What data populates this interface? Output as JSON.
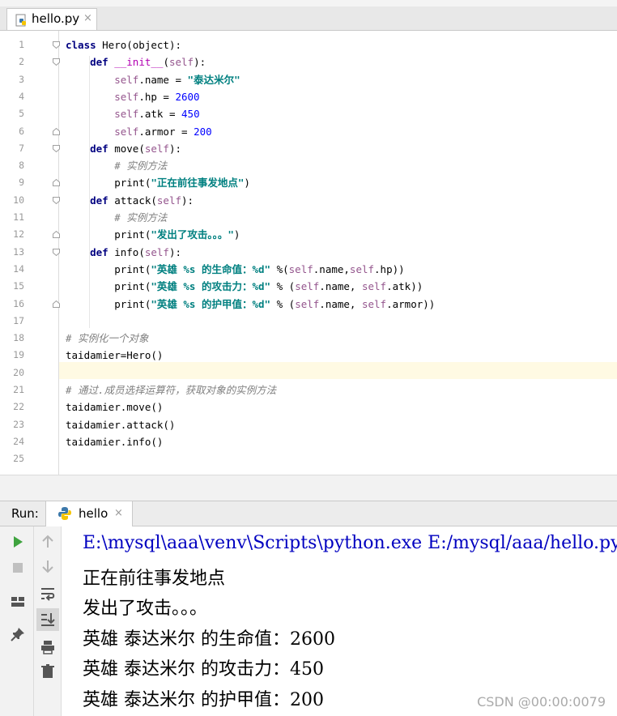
{
  "editor_tab": {
    "filename": "hello.py",
    "close": "×"
  },
  "code": {
    "line_numbers": [
      "1",
      "2",
      "3",
      "4",
      "5",
      "6",
      "7",
      "8",
      "9",
      "10",
      "11",
      "12",
      "13",
      "14",
      "15",
      "16",
      "17",
      "18",
      "19",
      "20",
      "21",
      "22",
      "23",
      "24",
      "25"
    ],
    "lines": [
      [
        {
          "t": "class ",
          "c": "kw"
        },
        {
          "t": "Hero(object):"
        }
      ],
      [
        {
          "t": "    "
        },
        {
          "t": "def ",
          "c": "kw"
        },
        {
          "t": "__init__",
          "c": "mg"
        },
        {
          "t": "("
        },
        {
          "t": "self",
          "c": "sf"
        },
        {
          "t": "):"
        }
      ],
      [
        {
          "t": "        "
        },
        {
          "t": "self",
          "c": "sf"
        },
        {
          "t": ".name = "
        },
        {
          "t": "\"泰达米尔\"",
          "c": "st"
        }
      ],
      [
        {
          "t": "        "
        },
        {
          "t": "self",
          "c": "sf"
        },
        {
          "t": ".hp = "
        },
        {
          "t": "2600",
          "c": "nu"
        }
      ],
      [
        {
          "t": "        "
        },
        {
          "t": "self",
          "c": "sf"
        },
        {
          "t": ".atk = "
        },
        {
          "t": "450",
          "c": "nu"
        }
      ],
      [
        {
          "t": "        "
        },
        {
          "t": "self",
          "c": "sf"
        },
        {
          "t": ".armor = "
        },
        {
          "t": "200",
          "c": "nu"
        }
      ],
      [
        {
          "t": "    "
        },
        {
          "t": "def ",
          "c": "kw"
        },
        {
          "t": "move("
        },
        {
          "t": "self",
          "c": "sf"
        },
        {
          "t": "):"
        }
      ],
      [
        {
          "t": "        "
        },
        {
          "t": "# 实例方法",
          "c": "cm"
        }
      ],
      [
        {
          "t": "        print("
        },
        {
          "t": "\"正在前往事发地点\"",
          "c": "st"
        },
        {
          "t": ")"
        }
      ],
      [
        {
          "t": "    "
        },
        {
          "t": "def ",
          "c": "kw"
        },
        {
          "t": "attack("
        },
        {
          "t": "self",
          "c": "sf"
        },
        {
          "t": "):"
        }
      ],
      [
        {
          "t": "        "
        },
        {
          "t": "# 实例方法",
          "c": "cm"
        }
      ],
      [
        {
          "t": "        print("
        },
        {
          "t": "\"发出了攻击。。。\"",
          "c": "st"
        },
        {
          "t": ")"
        }
      ],
      [
        {
          "t": "    "
        },
        {
          "t": "def ",
          "c": "kw"
        },
        {
          "t": "info("
        },
        {
          "t": "self",
          "c": "sf"
        },
        {
          "t": "):"
        }
      ],
      [
        {
          "t": "        print("
        },
        {
          "t": "\"英雄 %s 的生命值：%d\"",
          "c": "st"
        },
        {
          "t": " %("
        },
        {
          "t": "self",
          "c": "sf"
        },
        {
          "t": ".name,"
        },
        {
          "t": "self",
          "c": "sf"
        },
        {
          "t": ".hp))"
        }
      ],
      [
        {
          "t": "        print("
        },
        {
          "t": "\"英雄 %s 的攻击力：%d\"",
          "c": "st"
        },
        {
          "t": " % ("
        },
        {
          "t": "self",
          "c": "sf"
        },
        {
          "t": ".name, "
        },
        {
          "t": "self",
          "c": "sf"
        },
        {
          "t": ".atk))"
        }
      ],
      [
        {
          "t": "        print("
        },
        {
          "t": "\"英雄 %s 的护甲值：%d\"",
          "c": "st"
        },
        {
          "t": " % ("
        },
        {
          "t": "self",
          "c": "sf"
        },
        {
          "t": ".name, "
        },
        {
          "t": "self",
          "c": "sf"
        },
        {
          "t": ".armor))"
        }
      ],
      [],
      [
        {
          "t": "# 实例化一个对象",
          "c": "cm"
        }
      ],
      [
        {
          "t": "taidamier=Hero()"
        }
      ],
      [],
      [
        {
          "t": "# 通过.成员选择运算符，获取对象的实例方法",
          "c": "cm"
        }
      ],
      [
        {
          "t": "taidamier.move()"
        }
      ],
      [
        {
          "t": "taidamier.attack()"
        }
      ],
      [
        {
          "t": "taidamier.info()"
        }
      ],
      []
    ]
  },
  "run_panel": {
    "label": "Run:",
    "tab_name": "hello",
    "close": "×",
    "output": [
      "E:\\mysql\\aaa\\venv\\Scripts\\python.exe E:/mysql/aaa/hello.py",
      "正在前往事发地点",
      "发出了攻击。。。",
      "英雄 泰达米尔 的生命值：2600",
      "英雄 泰达米尔 的攻击力：450",
      "英雄 泰达米尔 的护甲值：200"
    ],
    "toolbar_icons": [
      "run-icon",
      "stop-icon",
      "layout-icon",
      "pin-icon",
      "up-arrow-icon",
      "down-arrow-icon",
      "soft-wrap-icon",
      "scroll-to-end-icon",
      "print-icon",
      "trash-icon"
    ]
  },
  "watermark": "CSDN @00:00:0079",
  "colors": {
    "keyword": "#000080",
    "self": "#94558d",
    "string": "#008080",
    "number": "#0000ff",
    "comment": "#808080",
    "magic": "#b200b2",
    "path": "#0000c0",
    "current_line": "#fffae3",
    "run_green": "#3fa33f"
  }
}
